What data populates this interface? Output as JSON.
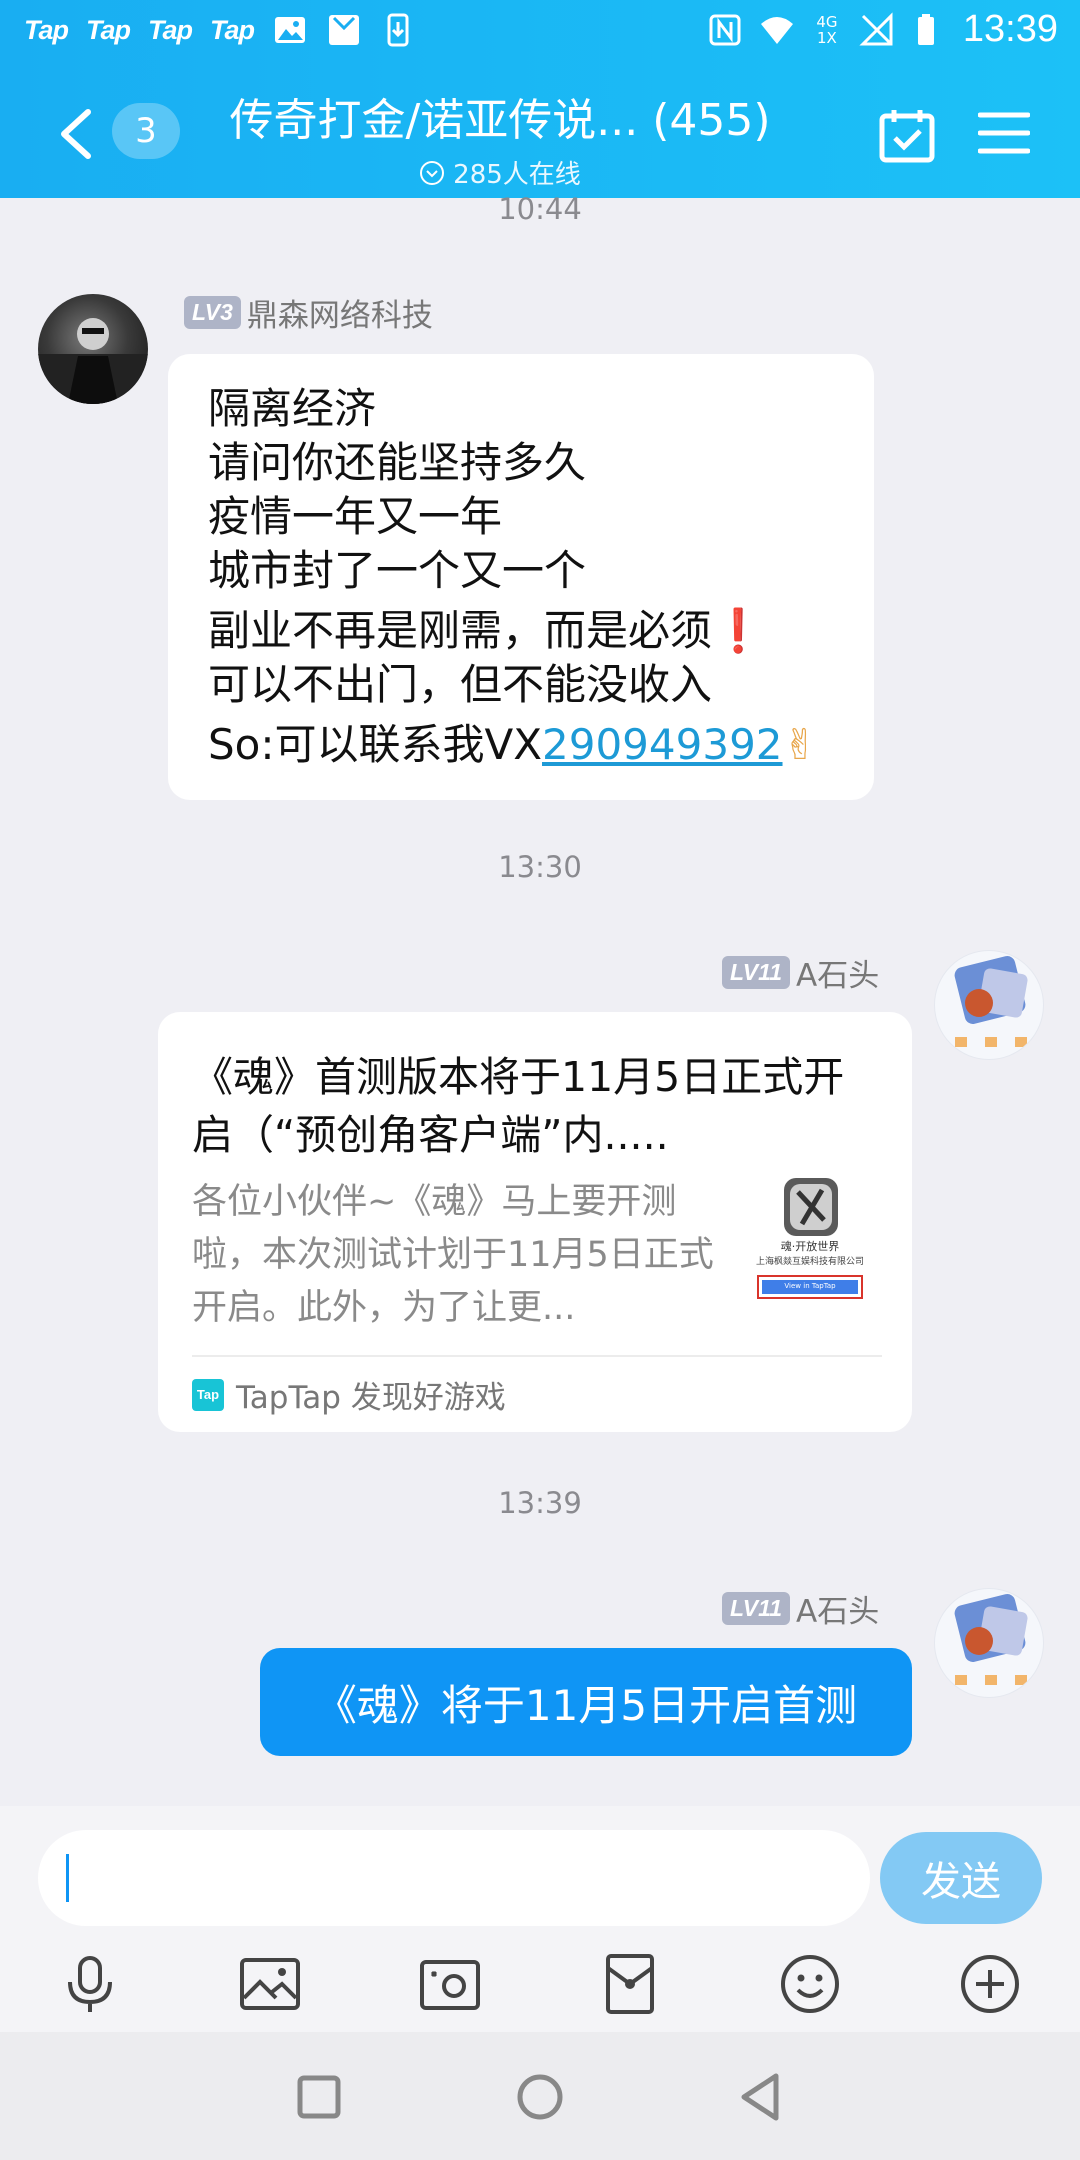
{
  "status_bar": {
    "app_badges": [
      "Tap",
      "Tap",
      "Tap",
      "Tap"
    ],
    "time": "13:39",
    "network": "4G 1X"
  },
  "header": {
    "back_icon": "chevron-left-icon",
    "unread_count": "3",
    "title": "传奇打金/诺亚传说... (455)",
    "online": "285人在线",
    "calendar_icon": "calendar-check-icon",
    "menu_icon": "menu-icon"
  },
  "messages": [
    {
      "time": "10:44",
      "sender": "鼎森网络科技",
      "level": "LV3",
      "lines": [
        "隔离经济",
        "请问你还能坚持多久",
        "疫情一年又一年",
        "城市封了一个又一个",
        "副业不再是刚需，而是必须",
        "可以不出门，但不能没收入"
      ],
      "excl": "❗",
      "contact_prefix": "So:可以联系我VX",
      "contact_link": "290949392",
      "emoji": "✌"
    },
    {
      "time": "13:30",
      "sender": "A石头",
      "level": "LV11",
      "card_title": "《魂》首测版本将于11月5日正式开启（“预创角客户端”内.....",
      "card_desc": "各位小伙伴~《魂》马上要开测啦，本次测试计划于11月5日正式开启。此外，为了让更...",
      "card_source": "TapTap 发现好游戏",
      "source_badge": "Tap",
      "thumb_caption": "魂·开放世界",
      "thumb_company": "上海枫燚互娱科技有限公司",
      "thumb_button": "View in TapTap"
    },
    {
      "time": "13:39",
      "sender": "A石头",
      "level": "LV11",
      "text": "《魂》将于11月5日开启首测"
    }
  ],
  "input": {
    "value": "",
    "send_label": "发送"
  },
  "toolbar_icons": [
    "microphone-icon",
    "image-icon",
    "camera-icon",
    "red-packet-icon",
    "emoji-icon",
    "add-icon"
  ],
  "colors": {
    "header": "#19aef2",
    "bubble_self": "#0f95f5",
    "send_disabled": "#83c9f4",
    "link": "#1d9ad6",
    "level_badge": "#aeb4c7"
  }
}
